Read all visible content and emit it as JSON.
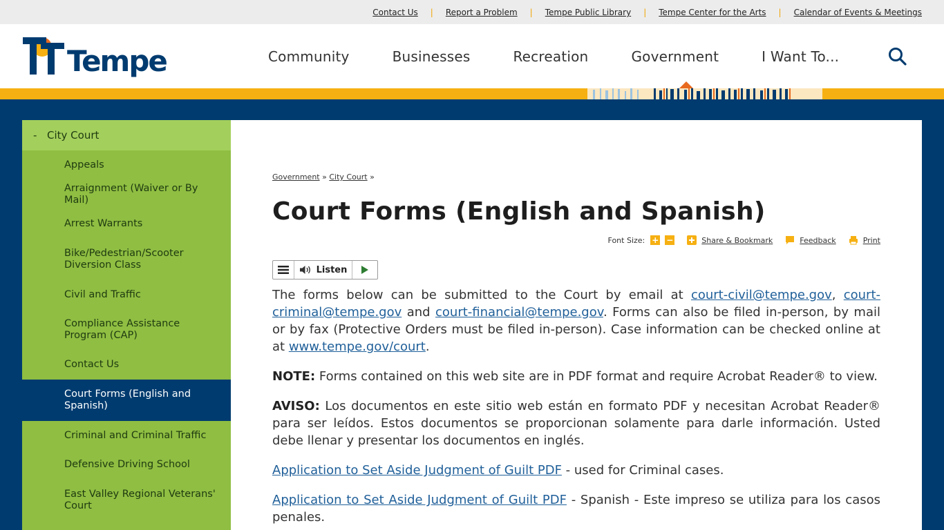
{
  "utility": {
    "links": [
      "Contact Us",
      "Report a Problem",
      "Tempe Public Library",
      "Tempe Center for the Arts",
      "Calendar of Events & Meetings"
    ]
  },
  "header": {
    "logo_text": "Tempe",
    "nav": [
      "Community",
      "Businesses",
      "Recreation",
      "Government",
      "I Want To..."
    ],
    "active_nav": "Government"
  },
  "colors": {
    "navy": "#003b6f",
    "gold": "#f6b012",
    "green": "#8fbe42",
    "green_light": "#a3cf5c",
    "link": "#1f5f99"
  },
  "sidebar": {
    "parent": "City Court",
    "items": [
      "Appeals",
      "Arraignment (Waiver or By Mail)",
      "Arrest Warrants",
      "Bike/Pedestrian/Scooter Diversion Class",
      "Civil and Traffic",
      "Compliance Assistance Program (CAP)",
      "Contact Us",
      "Court Forms (English and Spanish)",
      "Criminal and Criminal Traffic",
      "Defensive Driving School",
      "East Valley Regional Veterans' Court"
    ],
    "active_index": 7
  },
  "breadcrumb": {
    "items": [
      "Government",
      "City Court"
    ],
    "sep": "»"
  },
  "page": {
    "title": "Court Forms (English and Spanish)"
  },
  "tools": {
    "font_size_label": "Font Size:",
    "share": "Share & Bookmark",
    "feedback": "Feedback",
    "print": "Print"
  },
  "listen": {
    "label": "Listen"
  },
  "content": {
    "p1_text_a": "The forms below can be submitted to the Court by email at ",
    "email_civil": "court-civil@tempe.gov",
    "p1_comma": ", ",
    "email_criminal": "court-criminal@tempe.gov",
    "p1_and": " and ",
    "email_financial": "court-financial@tempe.gov",
    "p1_text_b": ".  Forms can also be filed in-person, by mail or by fax (Protective Orders must be filed in-person).  Case information can be checked online at at ",
    "court_url": "www.tempe.gov/court",
    "p1_end": ".",
    "note_label": "NOTE:",
    "note_text": " Forms contained on this web site are in PDF format and require Acrobat Reader® to view.",
    "aviso_label": "AVISO:",
    "aviso_text": " Los documentos en este sitio web están en formato PDF y necesitan Acrobat Reader® para ser leídos.  Estos documentos se proporcionan solamente para darle información. Usted debe llenar y presentar los documentos en inglés.",
    "form1_link": "Application to Set Aside Judgment of Guilt PDF",
    "form1_desc": "  - used for Criminal cases.",
    "form2_link": "Application to Set Aside Judgment of Guilt PDF",
    "form2_desc": " - Spanish - Este impreso se utiliza para los casos penales."
  }
}
